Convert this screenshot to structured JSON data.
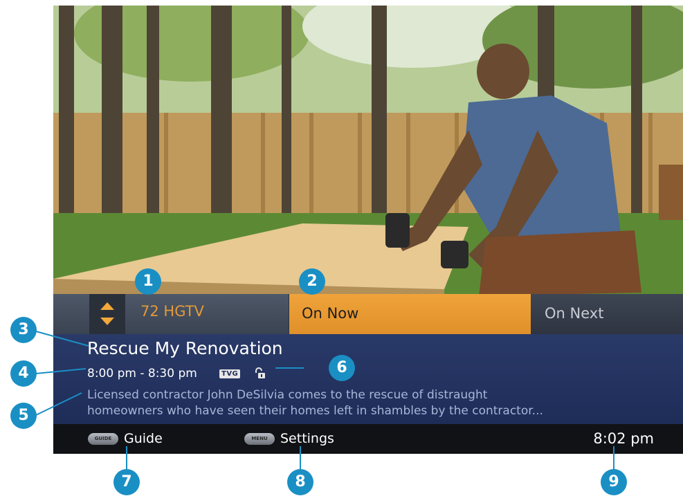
{
  "channel": {
    "label": "72 HGTV"
  },
  "tabs": {
    "now": "On Now",
    "next": "On Next"
  },
  "program": {
    "title": "Rescue My Renovation",
    "time": "8:00 pm - 8:30 pm",
    "rating": "TVG",
    "description_line1": "Licensed contractor John DeSilvia comes to the rescue of distraught",
    "description_line2": "homeowners who have seen their homes left in shambles by the contractor..."
  },
  "footer": {
    "guide_button": "GUIDE",
    "guide_label": "Guide",
    "menu_button": "MENU",
    "settings_label": "Settings",
    "clock": "8:02 pm"
  },
  "callouts": [
    "1",
    "2",
    "3",
    "4",
    "5",
    "6",
    "7",
    "8",
    "9"
  ],
  "colors": {
    "accent": "#f0a33a",
    "info_panel": "#24346a",
    "footer": "#101216",
    "callout": "#1a8fc4"
  },
  "icons": [
    "channel-up-down-icon",
    "parental-lock-icon",
    "guide-button-icon",
    "menu-button-icon"
  ]
}
